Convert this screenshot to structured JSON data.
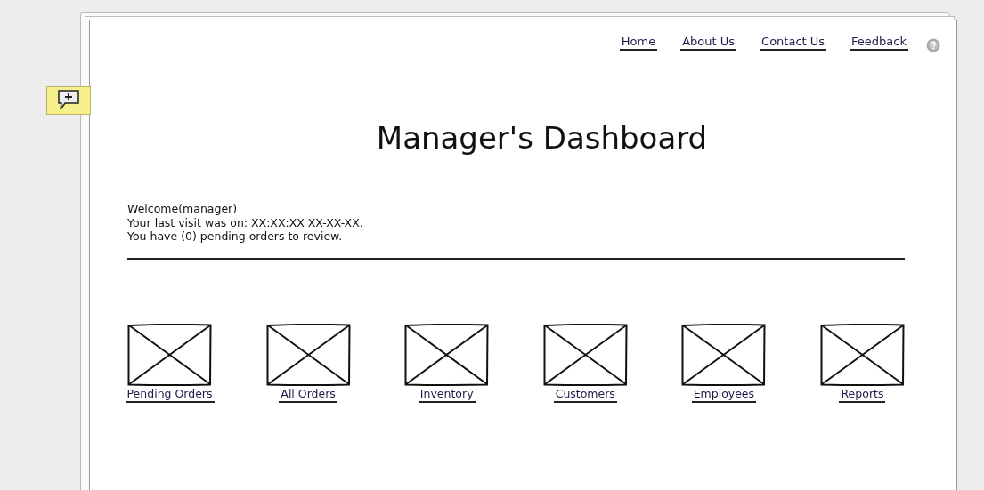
{
  "nav_links": [
    "Home",
    "About Us",
    "Contact Us",
    "Feedback"
  ],
  "title": "Manager's Dashboard",
  "welcome_lines": [
    "Welcome(manager)",
    "Your last visit was on: XX:XX:XX XX-XX-XX.",
    "You have (0) pending orders to review."
  ],
  "tiles": [
    {
      "label": "Pending Orders"
    },
    {
      "label": "All Orders"
    },
    {
      "label": "Inventory"
    },
    {
      "label": "Customers"
    },
    {
      "label": "Employees"
    },
    {
      "label": "Reports"
    }
  ]
}
